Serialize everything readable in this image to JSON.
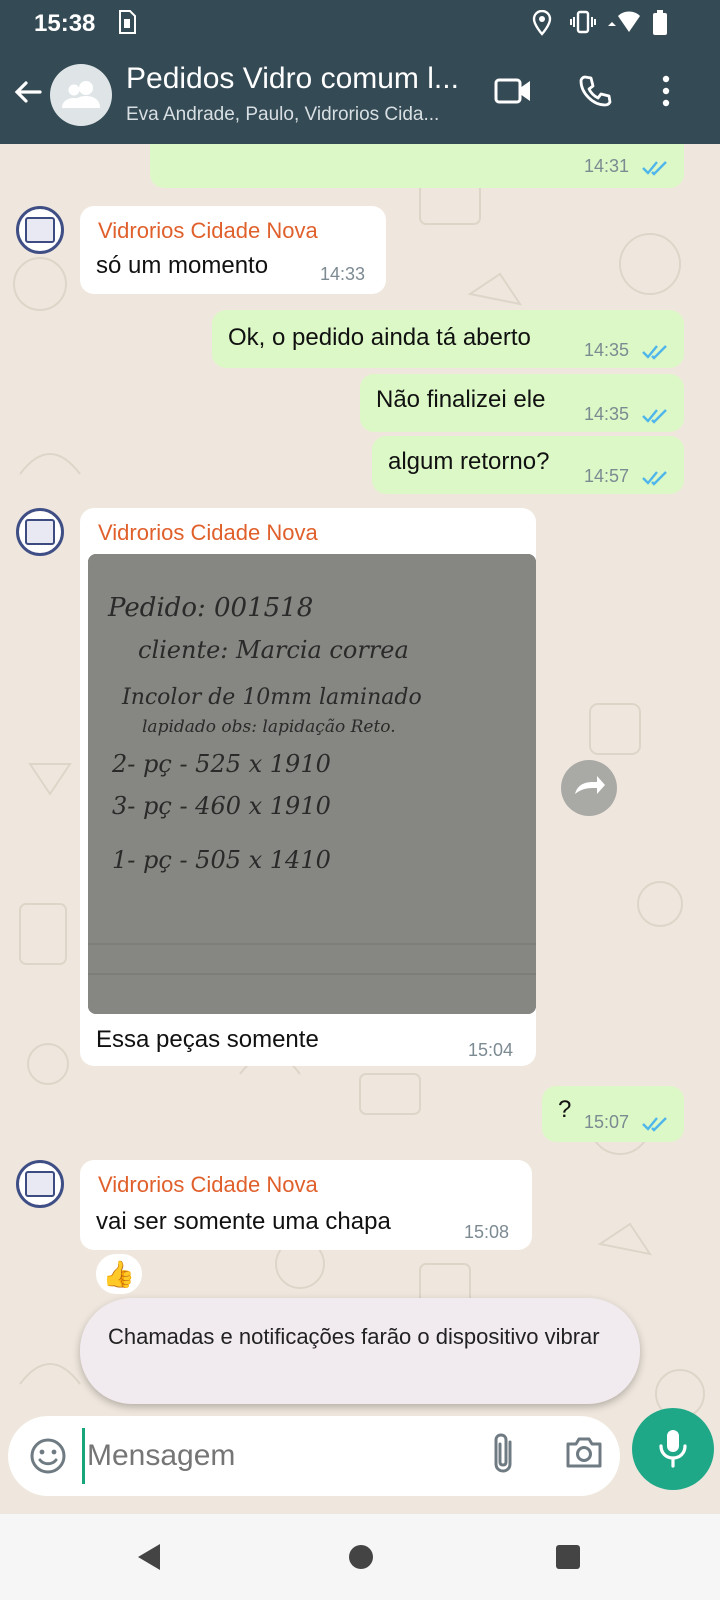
{
  "status_bar": {
    "time": "15:38",
    "icons": [
      "sim-alert-icon",
      "location-icon",
      "vibrate-icon",
      "wifi-icon",
      "battery-icon"
    ]
  },
  "header": {
    "title": "Pedidos Vidro comum l...",
    "subtitle": "Eva Andrade, Paulo, Vidrorios Cida...",
    "icons": [
      "back-arrow-icon",
      "group-avatar-icon",
      "video-call-icon",
      "voice-call-icon",
      "more-options-icon"
    ]
  },
  "messages": [
    {
      "id": "m1",
      "direction": "out",
      "text": "",
      "time": "14:31",
      "status": "read"
    },
    {
      "id": "m2",
      "direction": "in",
      "sender": "Vidrorios Cidade Nova",
      "text": "só um momento",
      "time": "14:33"
    },
    {
      "id": "m3",
      "direction": "out",
      "text": "Ok, o pedido ainda tá aberto",
      "time": "14:35",
      "status": "read"
    },
    {
      "id": "m4",
      "direction": "out",
      "text": "Não finalizei ele",
      "time": "14:35",
      "status": "read"
    },
    {
      "id": "m5",
      "direction": "out",
      "text": "algum retorno?",
      "time": "14:57",
      "status": "read"
    },
    {
      "id": "m6",
      "direction": "in",
      "sender": "Vidrorios Cidade Nova",
      "type": "image",
      "caption": "Essa peças somente",
      "time": "15:04",
      "image_handwriting": [
        "Pedido: 001518",
        "cliente: Marcia correa",
        "Incolor de 10mm laminado",
        "lapidado obs: lapidação Reto.",
        "2- pç - 525 x 1910",
        "3- pç - 460 x 1910",
        "1- pç - 505 x 1410"
      ]
    },
    {
      "id": "m7",
      "direction": "out",
      "text": "?",
      "time": "15:07",
      "status": "read"
    },
    {
      "id": "m8",
      "direction": "in",
      "sender": "Vidrorios Cidade Nova",
      "text": "vai ser somente uma chapa",
      "time": "15:08",
      "reaction": "👍"
    }
  ],
  "toast": {
    "text": "Chamadas e notificações farão o dispositivo vibrar"
  },
  "composer": {
    "placeholder": "Mensagem"
  },
  "colors": {
    "header_bg": "#344a55",
    "outgoing_bubble": "#dcf8c6",
    "incoming_bubble": "#ffffff",
    "sender_name": "#e0602c",
    "read_ticks": "#4fb6ec",
    "mic_button": "#1fa888",
    "chat_bg": "#efe7dd"
  }
}
